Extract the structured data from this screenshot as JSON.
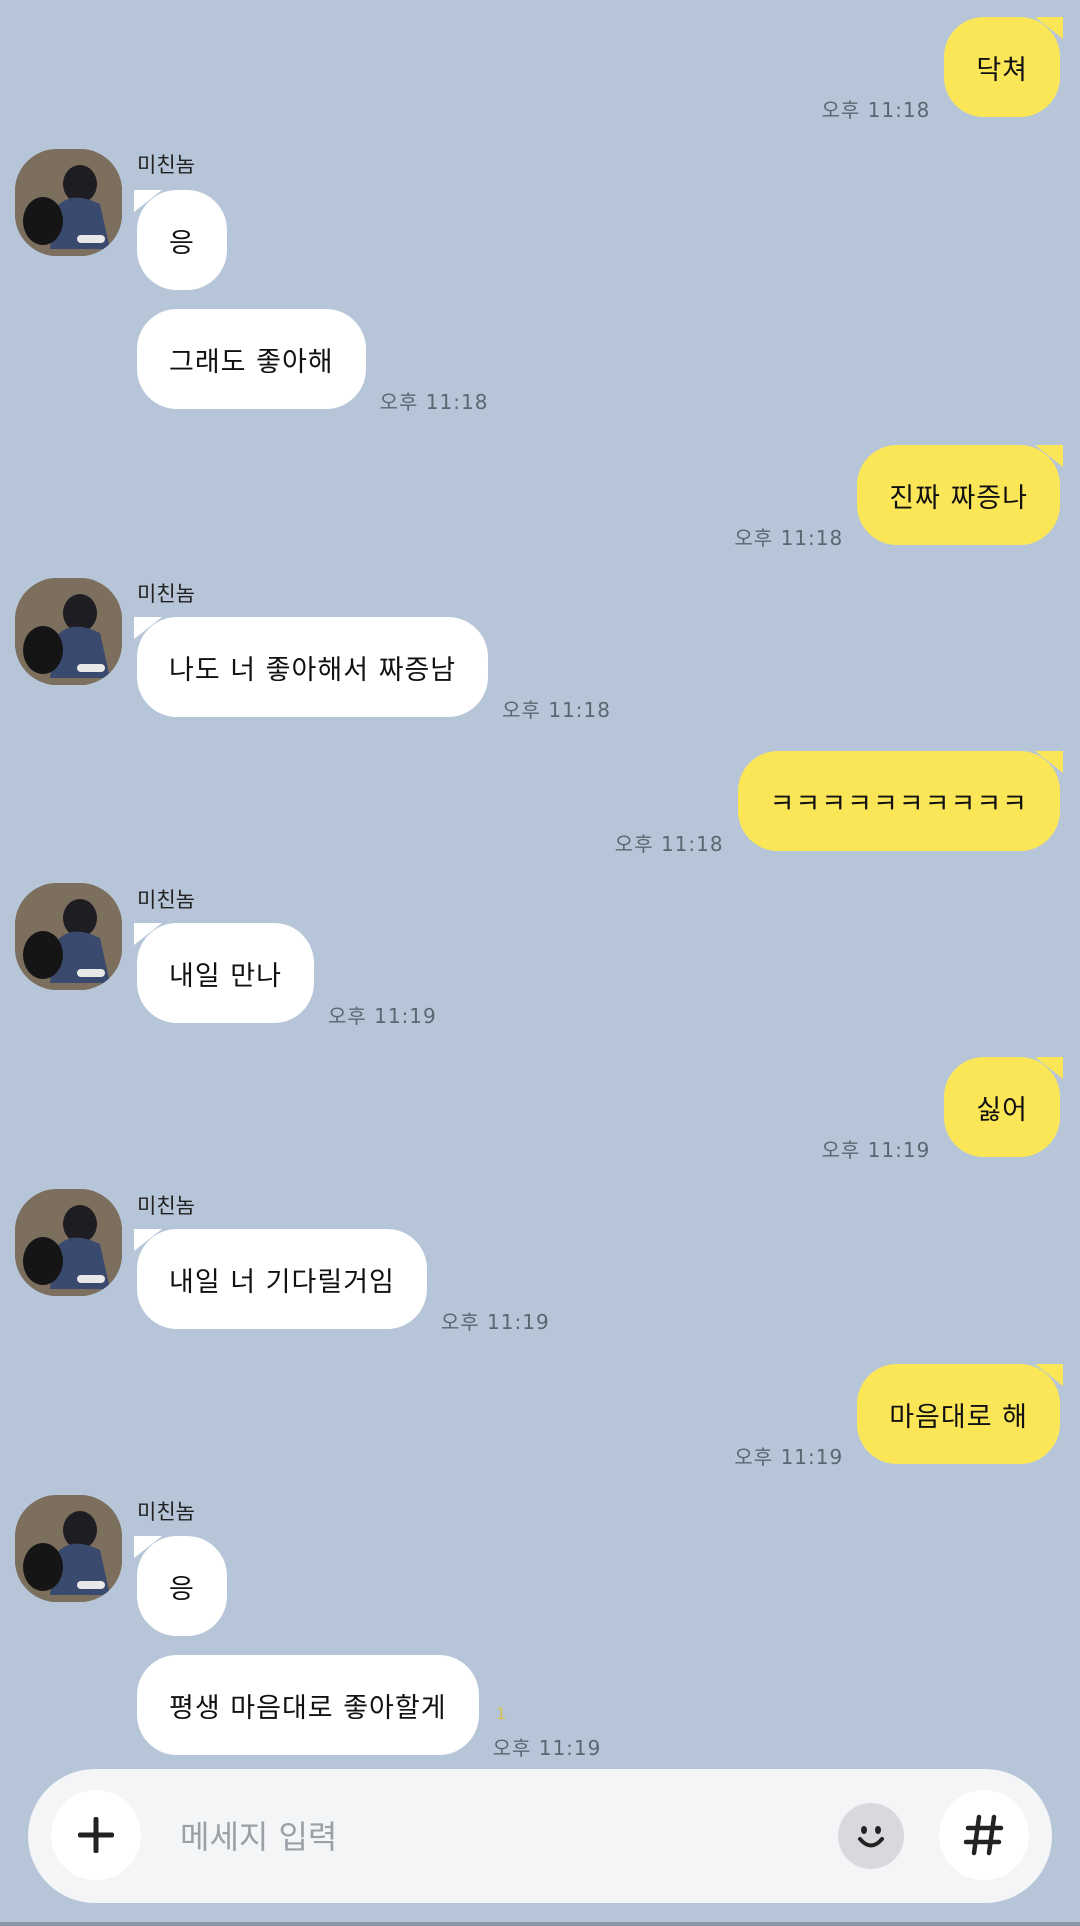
{
  "colors": {
    "background": "#b6c6d8",
    "my_bubble": "#fbe658",
    "their_bubble": "#ffffff",
    "composer": "#f4f5f7"
  },
  "sender_name": "미친놈",
  "messages": [
    {
      "from": "me",
      "text": "닥쳐",
      "time": "오후 11:18"
    },
    {
      "from": "them",
      "text": "응",
      "time": ""
    },
    {
      "from": "them",
      "text": "그래도 좋아해",
      "time": "오후 11:18"
    },
    {
      "from": "me",
      "text": "진짜 짜증나",
      "time": "오후 11:18"
    },
    {
      "from": "them",
      "text": "나도 너 좋아해서 짜증남",
      "time": "오후 11:18"
    },
    {
      "from": "me",
      "text": "ㅋㅋㅋㅋㅋㅋㅋㅋㅋㅋ",
      "time": "오후 11:18"
    },
    {
      "from": "them",
      "text": "내일 만나",
      "time": "오후 11:19"
    },
    {
      "from": "me",
      "text": "싫어",
      "time": "오후 11:19"
    },
    {
      "from": "them",
      "text": "내일 너 기다릴거임",
      "time": "오후 11:19"
    },
    {
      "from": "me",
      "text": "마음대로 해",
      "time": "오후 11:19"
    },
    {
      "from": "them",
      "text": "응",
      "time": ""
    },
    {
      "from": "them",
      "text": "평생 마음대로 좋아할게",
      "time": "오후 11:19",
      "unread": "1"
    }
  ],
  "composer": {
    "placeholder": "메세지 입력",
    "plus_icon": "plus-icon",
    "emoji_icon": "emoji-icon",
    "hash_icon": "hash-icon"
  }
}
